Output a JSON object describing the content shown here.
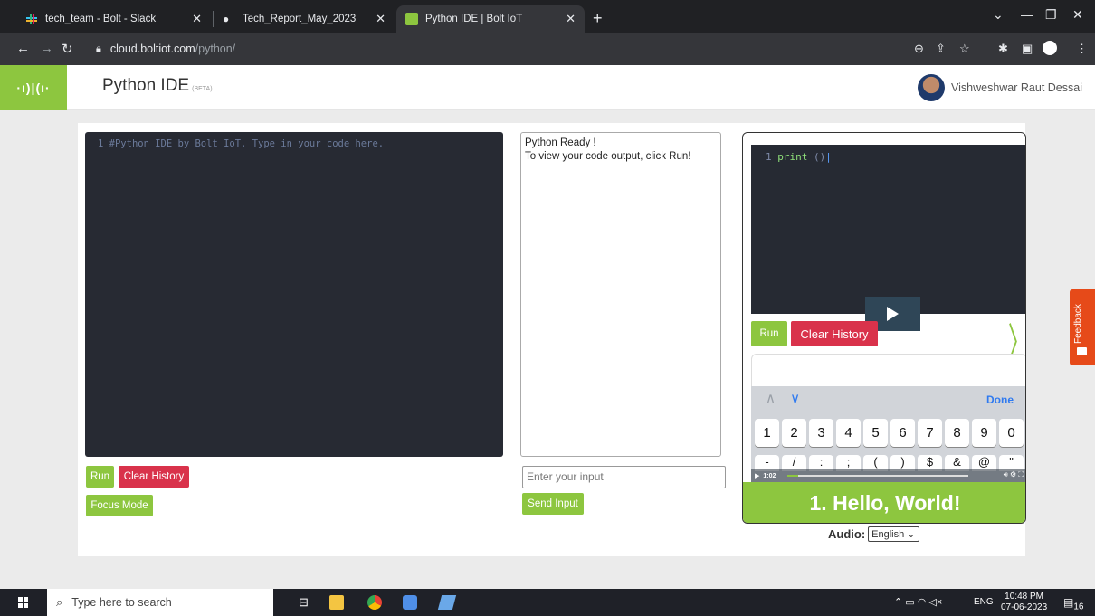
{
  "browser": {
    "tabs": [
      {
        "title": "tech_team - Bolt - Slack",
        "active": false
      },
      {
        "title": "Tech_Report_May_2023",
        "active": false
      },
      {
        "title": "Python IDE | Bolt IoT",
        "active": true
      }
    ],
    "url_host": "cloud.boltiot.com",
    "url_path": "/python/"
  },
  "header": {
    "logo_text": "·ı)|(ı·",
    "title": "Python IDE",
    "beta": "(BETA)",
    "user_name": "Vishweshwar Raut Dessai"
  },
  "editor": {
    "line_number": "1",
    "line_text": "#Python IDE by Bolt IoT. Type in your code here."
  },
  "controls": {
    "run_label": "Run",
    "clear_history_label": "Clear History",
    "focus_mode_label": "Focus Mode"
  },
  "output": {
    "line1": "Python Ready !",
    "line2": "To view your code output, click Run!"
  },
  "input": {
    "placeholder": "Enter your input",
    "send_label": "Send Input"
  },
  "video": {
    "code_line_number": "1",
    "code_keyword": "print",
    "code_rest": " ()",
    "run_label": "Run",
    "clear_history_label": "Clear History",
    "keyboard_done": "Done",
    "number_keys": [
      "1",
      "2",
      "3",
      "4",
      "5",
      "6",
      "7",
      "8",
      "9",
      "0"
    ],
    "symbol_keys": [
      "-",
      "/",
      ":",
      ";",
      "(",
      ")",
      "$",
      "&",
      "@",
      "\""
    ],
    "time": "1:02",
    "progress_fraction": 0.06,
    "banner_title": "1. Hello, World!"
  },
  "audio": {
    "label": "Audio:",
    "selected": "English",
    "options": [
      "English"
    ]
  },
  "feedback": {
    "label": "Feedback"
  },
  "taskbar": {
    "search_placeholder": "Type here to search",
    "language": "ENG",
    "time": "10:48 PM",
    "date": "07-06-2023",
    "notification_count": "16"
  },
  "colors": {
    "brand_green": "#8dc63f",
    "danger_red": "#d9324b",
    "feedback_orange": "#e64a19",
    "editor_bg": "#272a33"
  }
}
